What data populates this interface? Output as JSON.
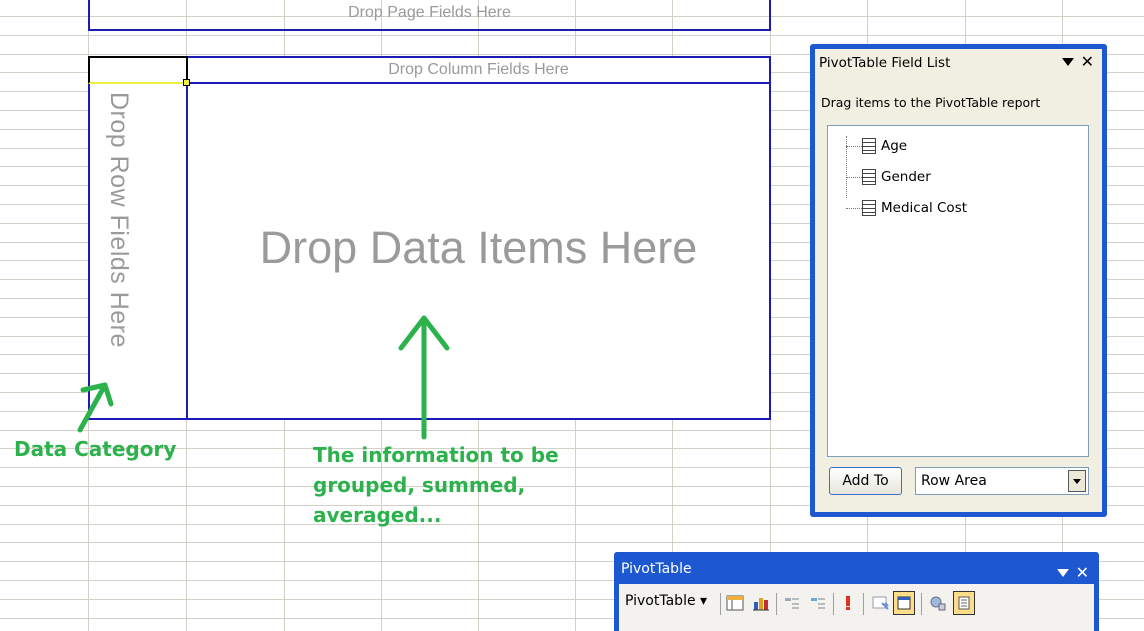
{
  "zones": {
    "page": "Drop Page Fields Here",
    "column": "Drop Column Fields Here",
    "row": "Drop Row Fields Here",
    "data": "Drop Data Items Here"
  },
  "annotations": {
    "category": "Data Category",
    "information": "The information to be grouped, summed, averaged..."
  },
  "field_list": {
    "title": "PivotTable Field List",
    "instruction": "Drag items to the PivotTable report",
    "fields": [
      "Age",
      "Gender",
      "Medical Cost"
    ],
    "add_button": "Add To",
    "area_value": "Row Area"
  },
  "toolbar": {
    "title": "PivotTable",
    "menu_label": "PivotTable",
    "buttons": [
      "format-report-icon",
      "chart-wizard-icon",
      "hide-detail-icon",
      "show-detail-icon",
      "refresh-icon",
      "include-hidden-items-icon",
      "field-settings-icon",
      "show-field-list-icon",
      "always-display-items-icon"
    ]
  },
  "colors": {
    "zone_border": "#1c1cb4",
    "annotation": "#2bb24c",
    "window_frame": "#1d58d0"
  }
}
